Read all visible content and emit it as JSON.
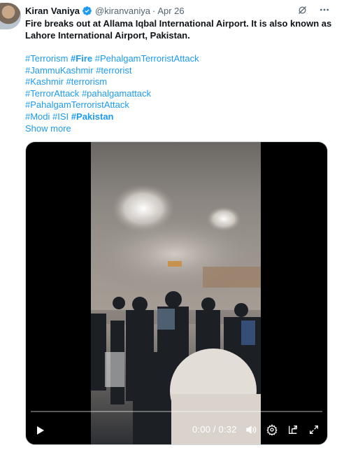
{
  "author": {
    "name": "Kiran Vaniya",
    "handle": "@kiranvaniya",
    "separator": "·",
    "date": "Apr 26"
  },
  "tweet": {
    "text": "Fire breaks out at Allama Iqbal International Airport. It is also known as Lahore International Airport, Pakistan.",
    "hashtag_lines": [
      [
        {
          "text": "#Terrorism",
          "bold": false
        },
        {
          "text": "#Fire",
          "bold": true
        },
        {
          "text": "#PehalgamTerroristAttack",
          "bold": false
        }
      ],
      [
        {
          "text": "#JammuKashmir",
          "bold": false
        },
        {
          "text": "#terrorist",
          "bold": false
        }
      ],
      [
        {
          "text": "#Kashmir",
          "bold": false
        },
        {
          "text": "#terrorism",
          "bold": false
        }
      ],
      [
        {
          "text": "#TerrorAttack",
          "bold": false
        },
        {
          "text": "#pahalgamattack",
          "bold": false
        }
      ],
      [
        {
          "text": "#PahalgamTerroristAttack",
          "bold": false
        }
      ],
      [
        {
          "text": "#Modi",
          "bold": false
        },
        {
          "text": "#ISI",
          "bold": false
        },
        {
          "text": "#Pakistan",
          "bold": true
        }
      ]
    ],
    "show_more": "Show more"
  },
  "video": {
    "time": "0:00 / 0:32",
    "progress": 0
  },
  "icons": {
    "verified": "verified-badge-icon",
    "grok": "grok-icon",
    "more": "more-options-icon",
    "play": "play-icon",
    "settings": "settings-gear-icon",
    "volume": "volume-icon",
    "pip": "picture-in-picture-icon",
    "fullscreen": "fullscreen-icon"
  },
  "colors": {
    "accent": "#1d9bf0",
    "text": "#0f1419",
    "secondary": "#536471"
  }
}
